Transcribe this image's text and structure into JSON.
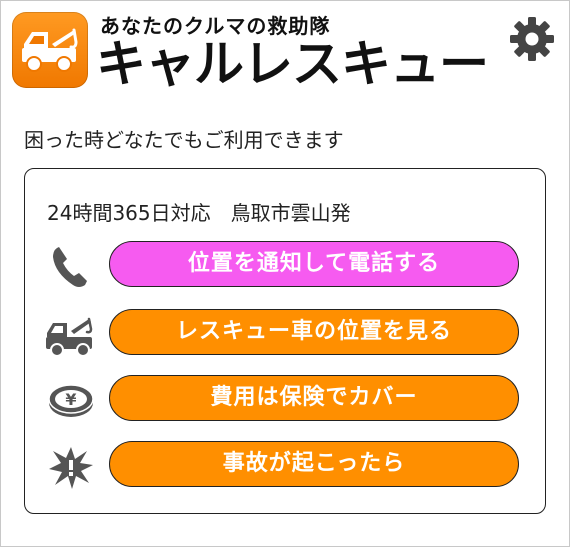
{
  "header": {
    "tagline": "あなたのクルマの救助隊",
    "app_name": "キャルレスキュー",
    "logo_icon": "tow-truck-icon",
    "settings_icon": "gear-icon"
  },
  "intro_text": "困った時どなたでもご利用できます",
  "panel": {
    "heading": "24時間365日対応　鳥取市雲山発",
    "actions": [
      {
        "icon": "phone-icon",
        "label": "位置を通知して電話する",
        "color": "#f65bf0"
      },
      {
        "icon": "tow-truck-icon",
        "label": "レスキュー車の位置を見る",
        "color": "#ff8f00"
      },
      {
        "icon": "yen-coin-icon",
        "label": "費用は保険でカバー",
        "color": "#ff8f00"
      },
      {
        "icon": "crash-icon",
        "label": "事故が起こったら",
        "color": "#ff8f00"
      }
    ]
  },
  "colors": {
    "accent_orange": "#ff8f00",
    "accent_magenta": "#f65bf0",
    "logo_orange": "#f07800",
    "text": "#222222"
  }
}
